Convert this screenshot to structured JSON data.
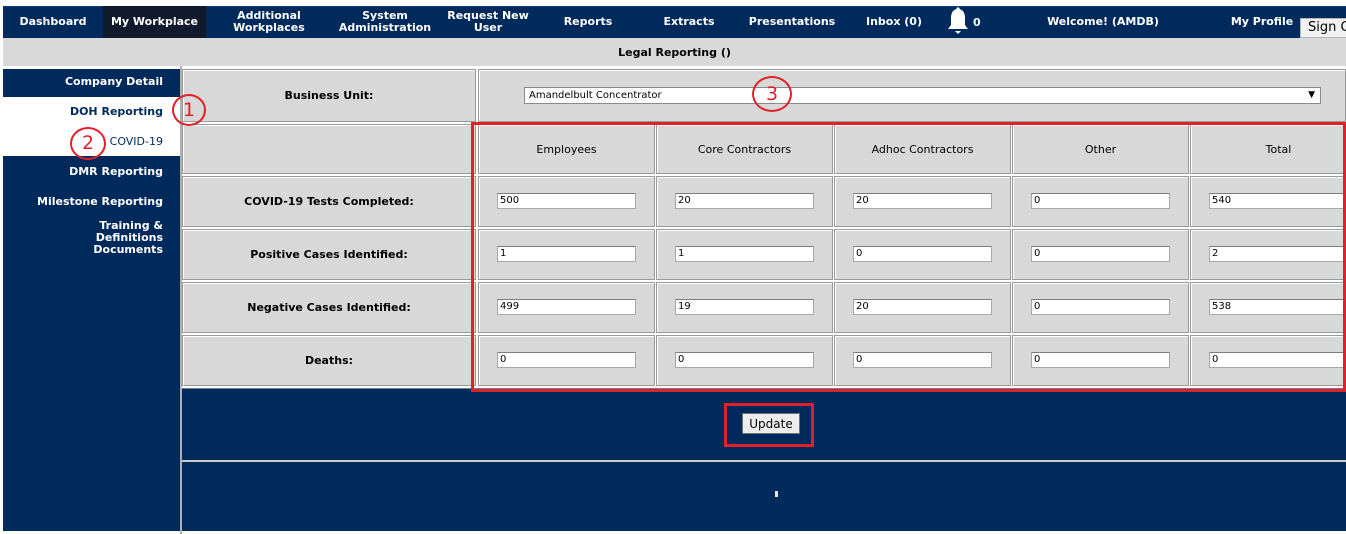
{
  "nav": {
    "items": [
      {
        "label": "Dashboard"
      },
      {
        "label": "My Workplace"
      },
      {
        "label": "Additional Workplaces"
      },
      {
        "label": "System Administration"
      },
      {
        "label": "Request New User"
      },
      {
        "label": "Reports"
      },
      {
        "label": "Extracts"
      },
      {
        "label": "Presentations"
      },
      {
        "label": "Inbox (0)"
      },
      {
        "label": "Welcome! (AMDB)"
      },
      {
        "label": "My Profile"
      }
    ],
    "bell_icon": "bell-icon",
    "notification_count": "0",
    "sign_out_label": "Sign C"
  },
  "page": {
    "title": "Legal Reporting ()"
  },
  "sidebar": {
    "items": [
      {
        "label": "Company Detail"
      },
      {
        "label": "DOH Reporting"
      },
      {
        "label": "COVID-19"
      },
      {
        "label": "DMR Reporting"
      },
      {
        "label": "Milestone Reporting"
      },
      {
        "label": "Training & Definitions Documents"
      }
    ]
  },
  "form": {
    "business_unit_label": "Business Unit:",
    "business_unit_value": "Amandelbult Concentrator",
    "columns": [
      "Employees",
      "Core Contractors",
      "Adhoc Contractors",
      "Other",
      "Total"
    ],
    "rows": [
      {
        "label": "COVID-19 Tests Completed:",
        "values": [
          "500",
          "20",
          "20",
          "0",
          "540"
        ]
      },
      {
        "label": "Positive Cases Identified:",
        "values": [
          "1",
          "1",
          "0",
          "0",
          "2"
        ]
      },
      {
        "label": "Negative Cases Identified:",
        "values": [
          "499",
          "19",
          "20",
          "0",
          "538"
        ]
      },
      {
        "label": "Deaths:",
        "values": [
          "0",
          "0",
          "0",
          "0",
          "0"
        ]
      }
    ],
    "update_label": "Update"
  },
  "annotations": {
    "labels": [
      "1",
      "2",
      "3"
    ],
    "color": "#e0202a"
  },
  "colors": {
    "navy": "#002a5c",
    "cell_grey": "#d8d8d8",
    "accent_red": "#e0202a"
  }
}
